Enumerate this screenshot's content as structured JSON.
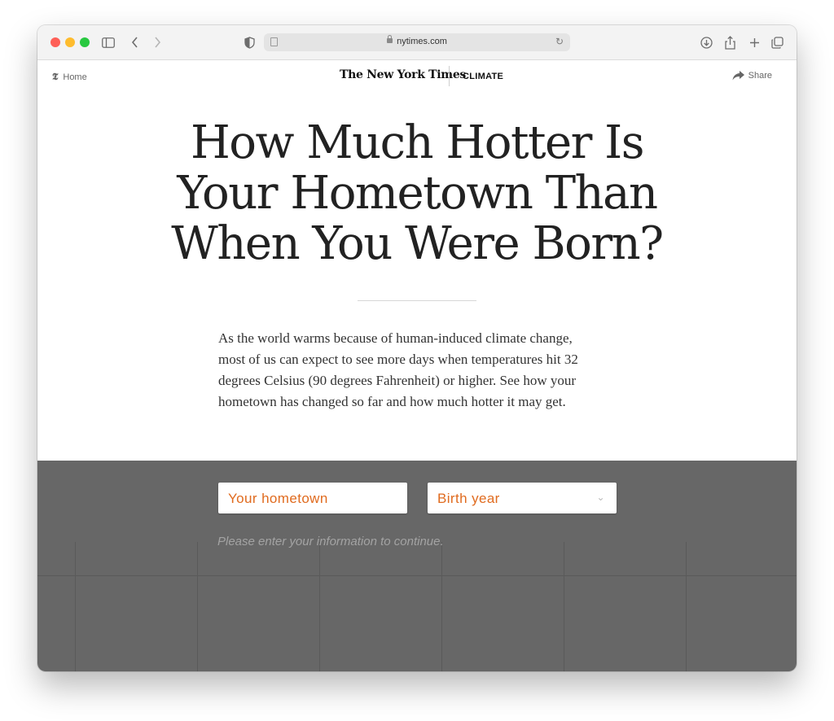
{
  "browser": {
    "url": "nytimes.com"
  },
  "header": {
    "home_label": "Home",
    "masthead": "The New York Times",
    "section": "CLIMATE",
    "share_label": "Share"
  },
  "article": {
    "headline_lines": [
      "How Much Hotter Is",
      "Your Hometown Than",
      "When You Were Born?"
    ],
    "dek": "As the world warms because of human-induced climate change, most of us can expect to see more days when temperatures hit 32 degrees Celsius (90 degrees Fahrenheit) or higher. See how your hometown has changed so far and how much hotter it may get."
  },
  "form": {
    "hometown_placeholder": "Your hometown",
    "birth_year_placeholder": "Birth year",
    "hint": "Please enter your information to continue."
  },
  "colors": {
    "accent": "#e06b1f",
    "panel_bg": "#676767",
    "headline": "#222222"
  }
}
